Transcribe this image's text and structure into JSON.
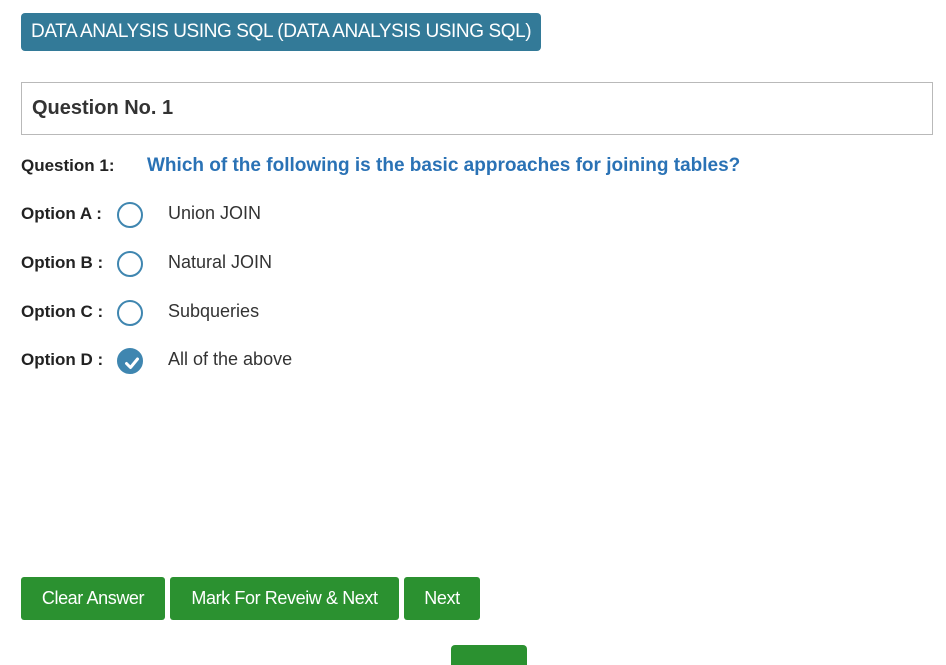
{
  "header": {
    "subject_title": "DATA ANALYSIS USING SQL (DATA ANALYSIS USING SQL)"
  },
  "question": {
    "number_heading": "Question No. 1",
    "label": "Question 1:",
    "text": "Which of the following is the basic approaches for joining tables?"
  },
  "options": [
    {
      "label": "Option A :",
      "text": "Union JOIN",
      "selected": false
    },
    {
      "label": "Option B :",
      "text": "Natural JOIN",
      "selected": false
    },
    {
      "label": "Option C :",
      "text": "Subqueries",
      "selected": false
    },
    {
      "label": "Option D :",
      "text": "All of the above",
      "selected": true
    }
  ],
  "actions": {
    "clear_label": "Clear Answer",
    "mark_label": "Mark For Reveiw & Next",
    "next_label": "Next"
  },
  "colors": {
    "badge": "#337a98",
    "question_text": "#2a72b5",
    "radio_accent": "#3f86b0",
    "button_green": "#2b9130"
  }
}
